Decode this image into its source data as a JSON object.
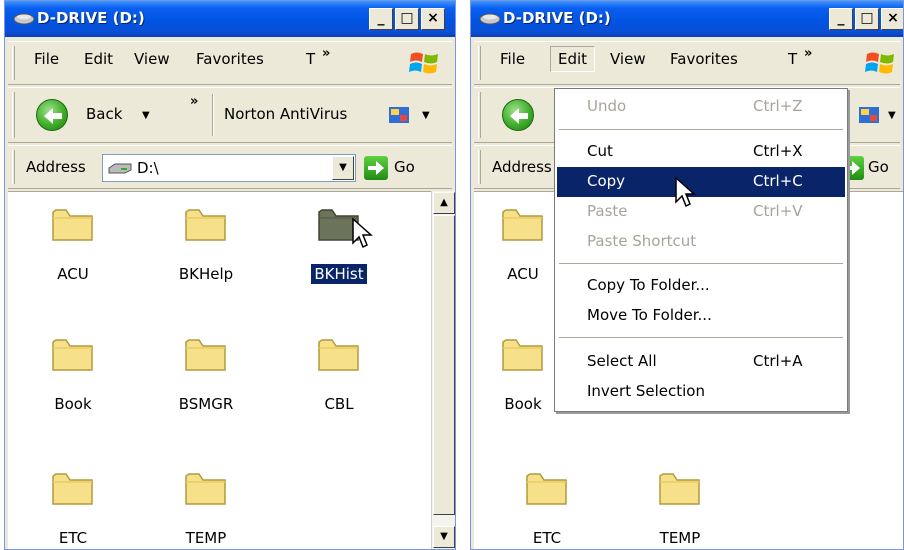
{
  "left_window": {
    "title": "D-DRIVE (D:)",
    "title_buttons": {
      "minimize": "_",
      "maximize": "□",
      "close": "×"
    },
    "menu": [
      "File",
      "Edit",
      "View",
      "Favorites",
      "T"
    ],
    "chevron": "»",
    "toolbar": {
      "back": "Back",
      "norton": "Norton AntiVirus",
      "chevron": "»"
    },
    "address": {
      "label": "Address",
      "value": "D:\\",
      "go": "Go"
    },
    "folders": [
      {
        "name": "ACU",
        "selected": false
      },
      {
        "name": "BKHelp",
        "selected": false
      },
      {
        "name": "BKHist",
        "selected": true
      },
      {
        "name": "Book",
        "selected": false
      },
      {
        "name": "BSMGR",
        "selected": false
      },
      {
        "name": "CBL",
        "selected": false
      },
      {
        "name": "ETC",
        "selected": false
      },
      {
        "name": "TEMP",
        "selected": false
      }
    ]
  },
  "right_window": {
    "title": "D-DRIVE (D:)",
    "title_buttons": {
      "minimize": "_",
      "maximize": "□",
      "close": "×"
    },
    "menu": [
      "File",
      "Edit",
      "View",
      "Favorites",
      "T"
    ],
    "chevron": "»",
    "address": {
      "label": "Address",
      "go": "Go"
    },
    "folders_visible": [
      "ACU",
      "Book",
      "ETC",
      "TEMP"
    ],
    "edit_menu": [
      {
        "label": "Undo",
        "shortcut": "Ctrl+Z",
        "enabled": false
      },
      {
        "label": "Cut",
        "shortcut": "Ctrl+X",
        "enabled": true
      },
      {
        "label": "Copy",
        "shortcut": "Ctrl+C",
        "enabled": true,
        "highlighted": true
      },
      {
        "label": "Paste",
        "shortcut": "Ctrl+V",
        "enabled": false
      },
      {
        "label": "Paste Shortcut",
        "shortcut": "",
        "enabled": false
      },
      {
        "label": "Copy To Folder...",
        "shortcut": "",
        "enabled": true
      },
      {
        "label": "Move To Folder...",
        "shortcut": "",
        "enabled": true
      },
      {
        "label": "Select All",
        "shortcut": "Ctrl+A",
        "enabled": true
      },
      {
        "label": "Invert Selection",
        "shortcut": "",
        "enabled": true
      }
    ]
  },
  "icons": [
    "drive-icon",
    "windows-logo-icon",
    "back-arrow-icon",
    "norton-icon",
    "go-arrow-icon",
    "folder-icon",
    "mouse-cursor-icon"
  ],
  "colors": {
    "titlebar": "#0054e3",
    "selection": "#0a246a",
    "folder": "#f7e08a",
    "chrome": "#ece9d8"
  }
}
